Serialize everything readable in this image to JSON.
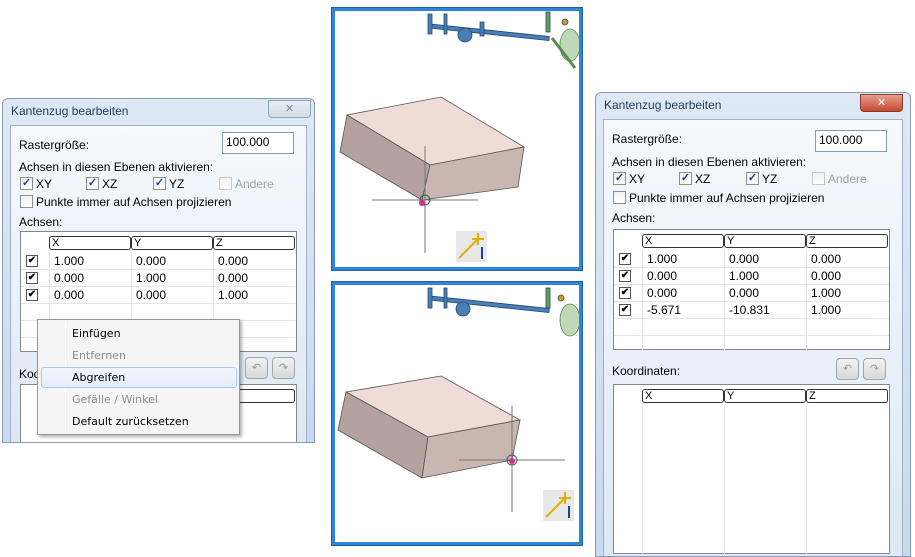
{
  "left_dialog": {
    "title": "Kantenzug bearbeiten",
    "close": "✕",
    "raster_label": "Rastergröße:",
    "raster_value": "100.000",
    "axes_planes_label": "Achsen in diesen Ebenen aktivieren:",
    "planes": [
      {
        "label": "XY",
        "checked": true
      },
      {
        "label": "XZ",
        "checked": true
      },
      {
        "label": "YZ",
        "checked": true
      },
      {
        "label": "Andere",
        "checked": false,
        "disabled": true
      }
    ],
    "project_label": "Punkte immer auf Achsen projizieren",
    "project_checked": false,
    "axes_label": "Achsen:",
    "columns": [
      "X",
      "Y",
      "Z"
    ],
    "rows": [
      [
        "1.000",
        "0.000",
        "0.000"
      ],
      [
        "0.000",
        "1.000",
        "0.000"
      ],
      [
        "0.000",
        "0.000",
        "1.000"
      ]
    ],
    "coords_label": "Koo",
    "undo": "↶",
    "redo": "↷"
  },
  "context_menu": {
    "items": [
      {
        "label": "Einfügen",
        "disabled": false
      },
      {
        "label": "Entfernen",
        "disabled": true
      },
      {
        "label": "Abgreifen",
        "disabled": false,
        "highlighted": true
      },
      {
        "label": "Gefälle / Winkel",
        "disabled": true
      },
      {
        "label": "Default zurücksetzen",
        "disabled": false
      }
    ]
  },
  "right_dialog": {
    "title": "Kantenzug bearbeiten",
    "close": "✕",
    "raster_label": "Rastergröße:",
    "raster_value": "100.000",
    "axes_planes_label": "Achsen in diesen Ebenen aktivieren:",
    "planes": [
      {
        "label": "XY",
        "checked": true
      },
      {
        "label": "XZ",
        "checked": true
      },
      {
        "label": "YZ",
        "checked": true
      },
      {
        "label": "Andere",
        "checked": false,
        "disabled": true
      }
    ],
    "project_label": "Punkte immer auf Achsen projizieren",
    "project_checked": false,
    "axes_label": "Achsen:",
    "columns": [
      "X",
      "Y",
      "Z"
    ],
    "rows": [
      [
        "1.000",
        "0.000",
        "0.000"
      ],
      [
        "0.000",
        "1.000",
        "0.000"
      ],
      [
        "0.000",
        "0.000",
        "1.000"
      ],
      [
        "-5.671",
        "-10.831",
        "1.000"
      ]
    ],
    "coords_label": "Koordinaten:",
    "coord_columns": [
      "X",
      "Y",
      "Z"
    ],
    "undo": "↶",
    "redo": "↷"
  },
  "colors": {
    "viewport_border": "#2f86d8",
    "box_top": "#f0dcd6",
    "box_side": "#b8a7a3",
    "pipe": "#4a7fb5"
  },
  "check": "✔",
  "check_small": "✓"
}
